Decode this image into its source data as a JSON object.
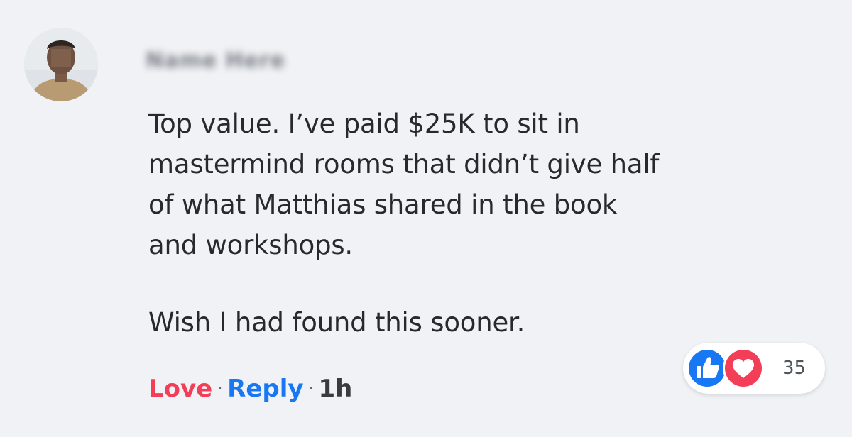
{
  "comment": {
    "author_name": "Name Here",
    "text_paragraphs": [
      "Top value. I’ve paid $25K to sit in\nmastermind rooms that didn’t give half\nof what Matthias shared in the book\nand workshops.",
      "Wish I had found this sooner."
    ],
    "actions": {
      "love_label": "Love",
      "separator": "·",
      "reply_label": "Reply",
      "time": "1h"
    },
    "reactions": {
      "icons": [
        "like-icon",
        "love-icon"
      ],
      "count": "35"
    }
  },
  "colors": {
    "background": "#f0f2f5",
    "love_accent": "#f33e58",
    "reply_accent": "#1877f2",
    "like_icon": "#1877f2",
    "love_icon": "#f33e58"
  }
}
